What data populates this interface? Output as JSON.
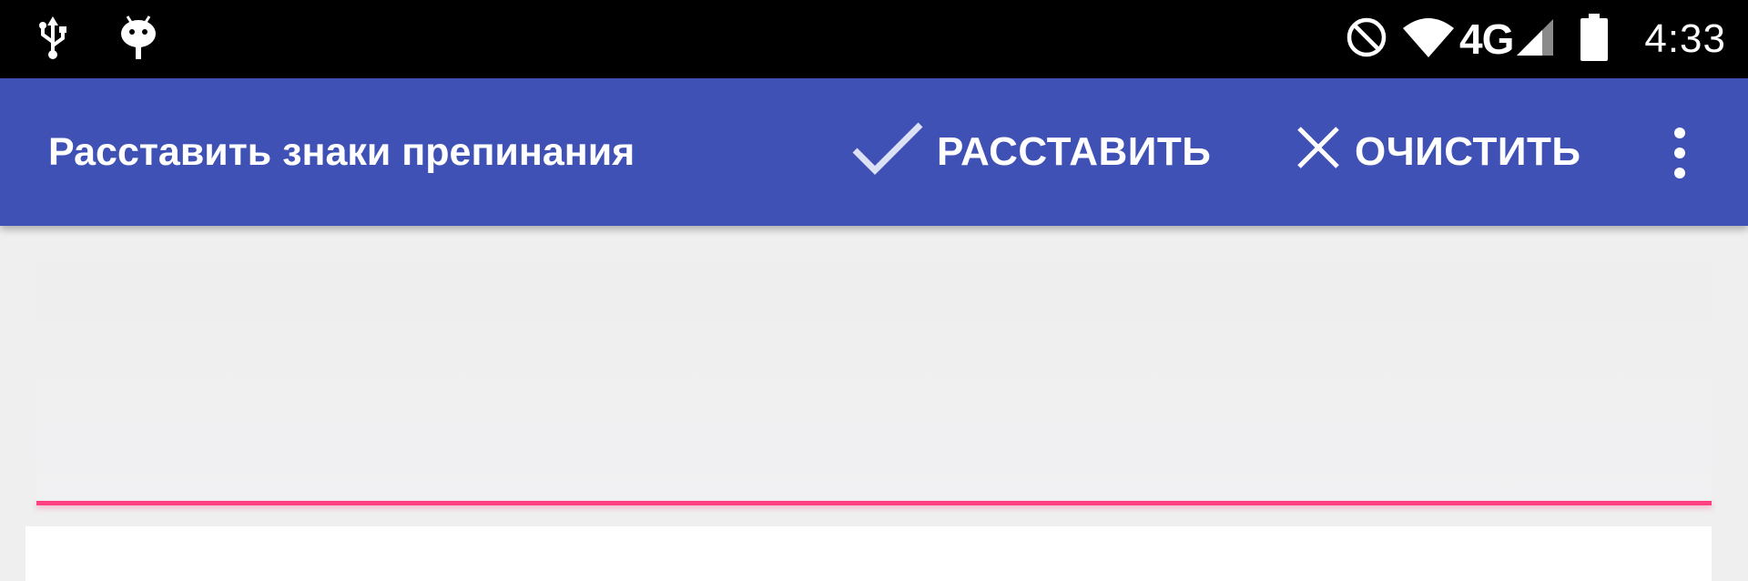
{
  "status_bar": {
    "left_icons": [
      "usb-icon",
      "android-debug-icon"
    ],
    "right_icons": [
      "do-not-disturb-icon",
      "wifi-icon",
      "cell-signal-icon",
      "battery-icon"
    ],
    "network": "4G",
    "time": "4:33"
  },
  "app_bar": {
    "title": "Расставить знаки препинания",
    "actions": [
      {
        "label": "РАССТАВИТЬ",
        "icon": "check-icon"
      },
      {
        "label": "ОЧИСТИТЬ",
        "icon": "close-icon"
      }
    ],
    "overflow_icon": "more-vert-icon"
  },
  "input": {
    "value": "",
    "placeholder": ""
  },
  "colors": {
    "status_bar": "#000000",
    "app_bar": "#3f51b5",
    "accent": "#ff4081",
    "background": "#efefef",
    "card": "#ffffff"
  }
}
